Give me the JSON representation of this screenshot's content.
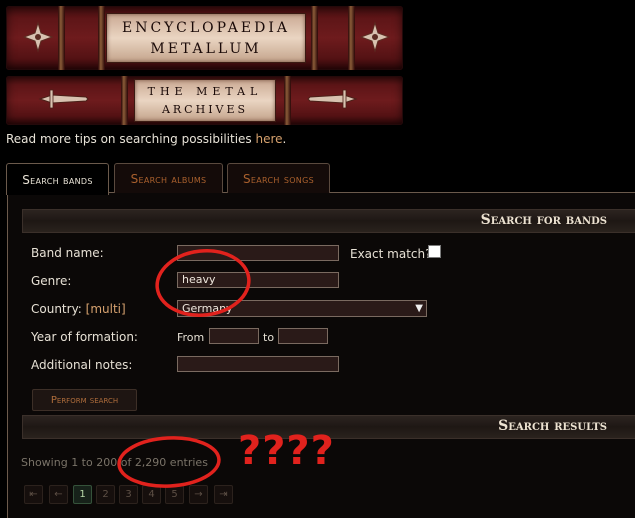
{
  "header": {
    "top_line1": "ENCYCLOPAEDIA",
    "top_line2": "METALLUM",
    "bottom_line1": "THE METAL",
    "bottom_line2": "ARCHIVES"
  },
  "tips": {
    "prefix": "Read more tips on searching possibilities ",
    "link": "here",
    "suffix": "."
  },
  "tabs": [
    "Search bands",
    "Search albums",
    "Search songs"
  ],
  "search_section_title": "Search for bands",
  "form": {
    "band_name_label": "Band name:",
    "band_name_value": "",
    "exact_match_label": "Exact match?",
    "genre_label": "Genre:",
    "genre_value": "heavy",
    "country_label": "Country: ",
    "country_multi": "[multi]",
    "country_value": "Germany",
    "year_label": "Year of formation:",
    "from_label": "From",
    "to_label": "to",
    "notes_label": "Additional notes:",
    "submit_label": "Perform search"
  },
  "results_section_title": "Search results",
  "results": {
    "entries_text": "Showing 1 to 200 of 2,290 entries"
  },
  "pagination": {
    "first": "⇤",
    "prev": "←",
    "pages": [
      "1",
      "2",
      "3",
      "4",
      "5"
    ],
    "current_page": "1",
    "next": "→",
    "last": "⇥"
  },
  "annotation": {
    "text": "????",
    "color": "#e1221d"
  },
  "colors": {
    "accent": "#d6a16d",
    "tab_inactive": "#a9602d",
    "book_red": "#6e1b1d"
  }
}
